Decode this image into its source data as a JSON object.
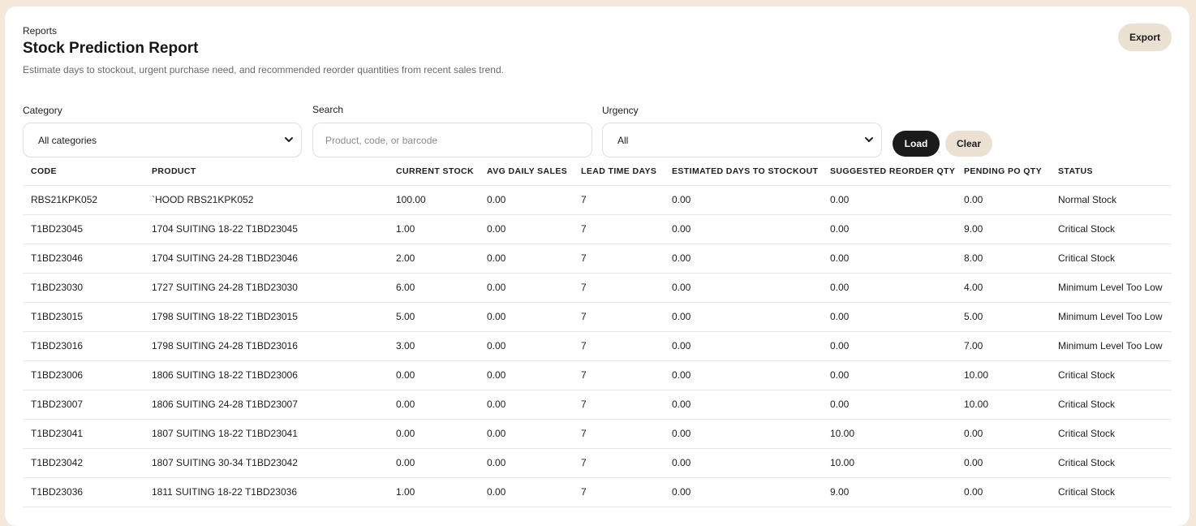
{
  "header": {
    "breadcrumb": "Reports",
    "title": "Stock Prediction Report",
    "subtitle": "Estimate days to stockout, urgent purchase need, and recommended reorder quantities from recent sales trend.",
    "export_label": "Export"
  },
  "filters": {
    "category_label": "Category",
    "category_value": "All categories",
    "search_label": "Search",
    "search_placeholder": "Product, code, or barcode",
    "urgency_label": "Urgency",
    "urgency_value": "All",
    "load_label": "Load",
    "clear_label": "Clear"
  },
  "table": {
    "columns": [
      "CODE",
      "PRODUCT",
      "CURRENT STOCK",
      "AVG DAILY SALES",
      "LEAD TIME DAYS",
      "ESTIMATED DAYS TO STOCKOUT",
      "SUGGESTED REORDER QTY",
      "PENDING PO QTY",
      "STATUS"
    ],
    "rows": [
      [
        "RBS21KPK052",
        "`HOOD RBS21KPK052",
        "100.00",
        "0.00",
        "7",
        "0.00",
        "0.00",
        "0.00",
        "Normal Stock"
      ],
      [
        "T1BD23045",
        "1704 SUITING 18-22 T1BD23045",
        "1.00",
        "0.00",
        "7",
        "0.00",
        "0.00",
        "9.00",
        "Critical Stock"
      ],
      [
        "T1BD23046",
        "1704 SUITING 24-28 T1BD23046",
        "2.00",
        "0.00",
        "7",
        "0.00",
        "0.00",
        "8.00",
        "Critical Stock"
      ],
      [
        "T1BD23030",
        "1727 SUITING 24-28 T1BD23030",
        "6.00",
        "0.00",
        "7",
        "0.00",
        "0.00",
        "4.00",
        "Minimum Level Too Low"
      ],
      [
        "T1BD23015",
        "1798 SUITING 18-22 T1BD23015",
        "5.00",
        "0.00",
        "7",
        "0.00",
        "0.00",
        "5.00",
        "Minimum Level Too Low"
      ],
      [
        "T1BD23016",
        "1798 SUITING 24-28 T1BD23016",
        "3.00",
        "0.00",
        "7",
        "0.00",
        "0.00",
        "7.00",
        "Minimum Level Too Low"
      ],
      [
        "T1BD23006",
        "1806 SUITING 18-22 T1BD23006",
        "0.00",
        "0.00",
        "7",
        "0.00",
        "0.00",
        "10.00",
        "Critical Stock"
      ],
      [
        "T1BD23007",
        "1806 SUITING 24-28 T1BD23007",
        "0.00",
        "0.00",
        "7",
        "0.00",
        "0.00",
        "10.00",
        "Critical Stock"
      ],
      [
        "T1BD23041",
        "1807 SUITING 18-22 T1BD23041",
        "0.00",
        "0.00",
        "7",
        "0.00",
        "10.00",
        "0.00",
        "Critical Stock"
      ],
      [
        "T1BD23042",
        "1807 SUITING 30-34 T1BD23042",
        "0.00",
        "0.00",
        "7",
        "0.00",
        "10.00",
        "0.00",
        "Critical Stock"
      ],
      [
        "T1BD23036",
        "1811 SUITING 18-22 T1BD23036",
        "1.00",
        "0.00",
        "7",
        "0.00",
        "9.00",
        "0.00",
        "Critical Stock"
      ]
    ]
  }
}
